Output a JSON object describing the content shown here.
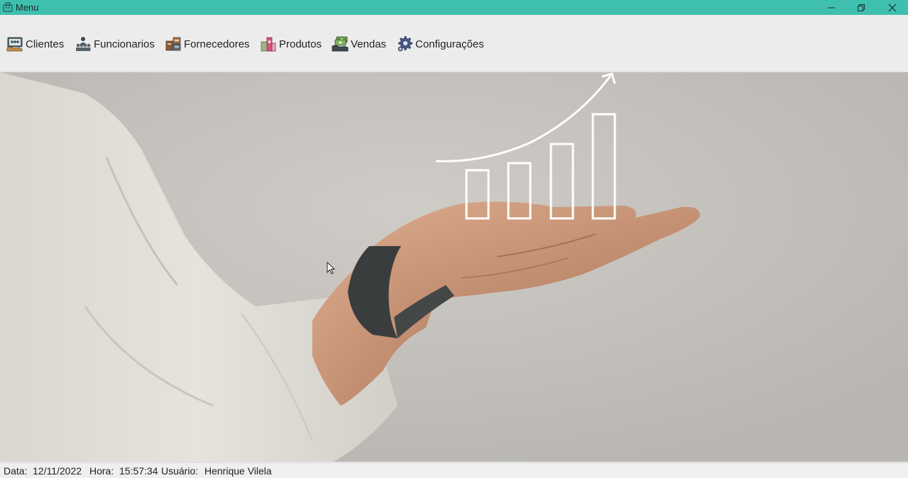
{
  "window": {
    "title": "Menu",
    "app_icon": "app-icon",
    "controls": [
      "minimize-icon",
      "maximize-icon",
      "close-icon"
    ]
  },
  "menu": {
    "items": [
      {
        "label": "Clientes",
        "icon": "clients-icon"
      },
      {
        "label": "Funcionarios",
        "icon": "employees-icon"
      },
      {
        "label": "Fornecedores",
        "icon": "suppliers-icon"
      },
      {
        "label": "Produtos",
        "icon": "products-icon"
      },
      {
        "label": "Vendas",
        "icon": "sales-icon"
      },
      {
        "label": "Configurações",
        "icon": "settings-gear-icon"
      }
    ]
  },
  "hero": {
    "description_icon": "hand-with-growth-chart-image"
  },
  "status": {
    "date_label": "Data:",
    "date_value": "12/11/2022",
    "time_label": "Hora:",
    "time_value": "15:57:34",
    "user_label": "Usuário:",
    "user_value": "Henrique Vilela"
  },
  "colors": {
    "titlebar": "#3fbfad",
    "menubar": "#ececec",
    "statusbar": "#efefef"
  }
}
